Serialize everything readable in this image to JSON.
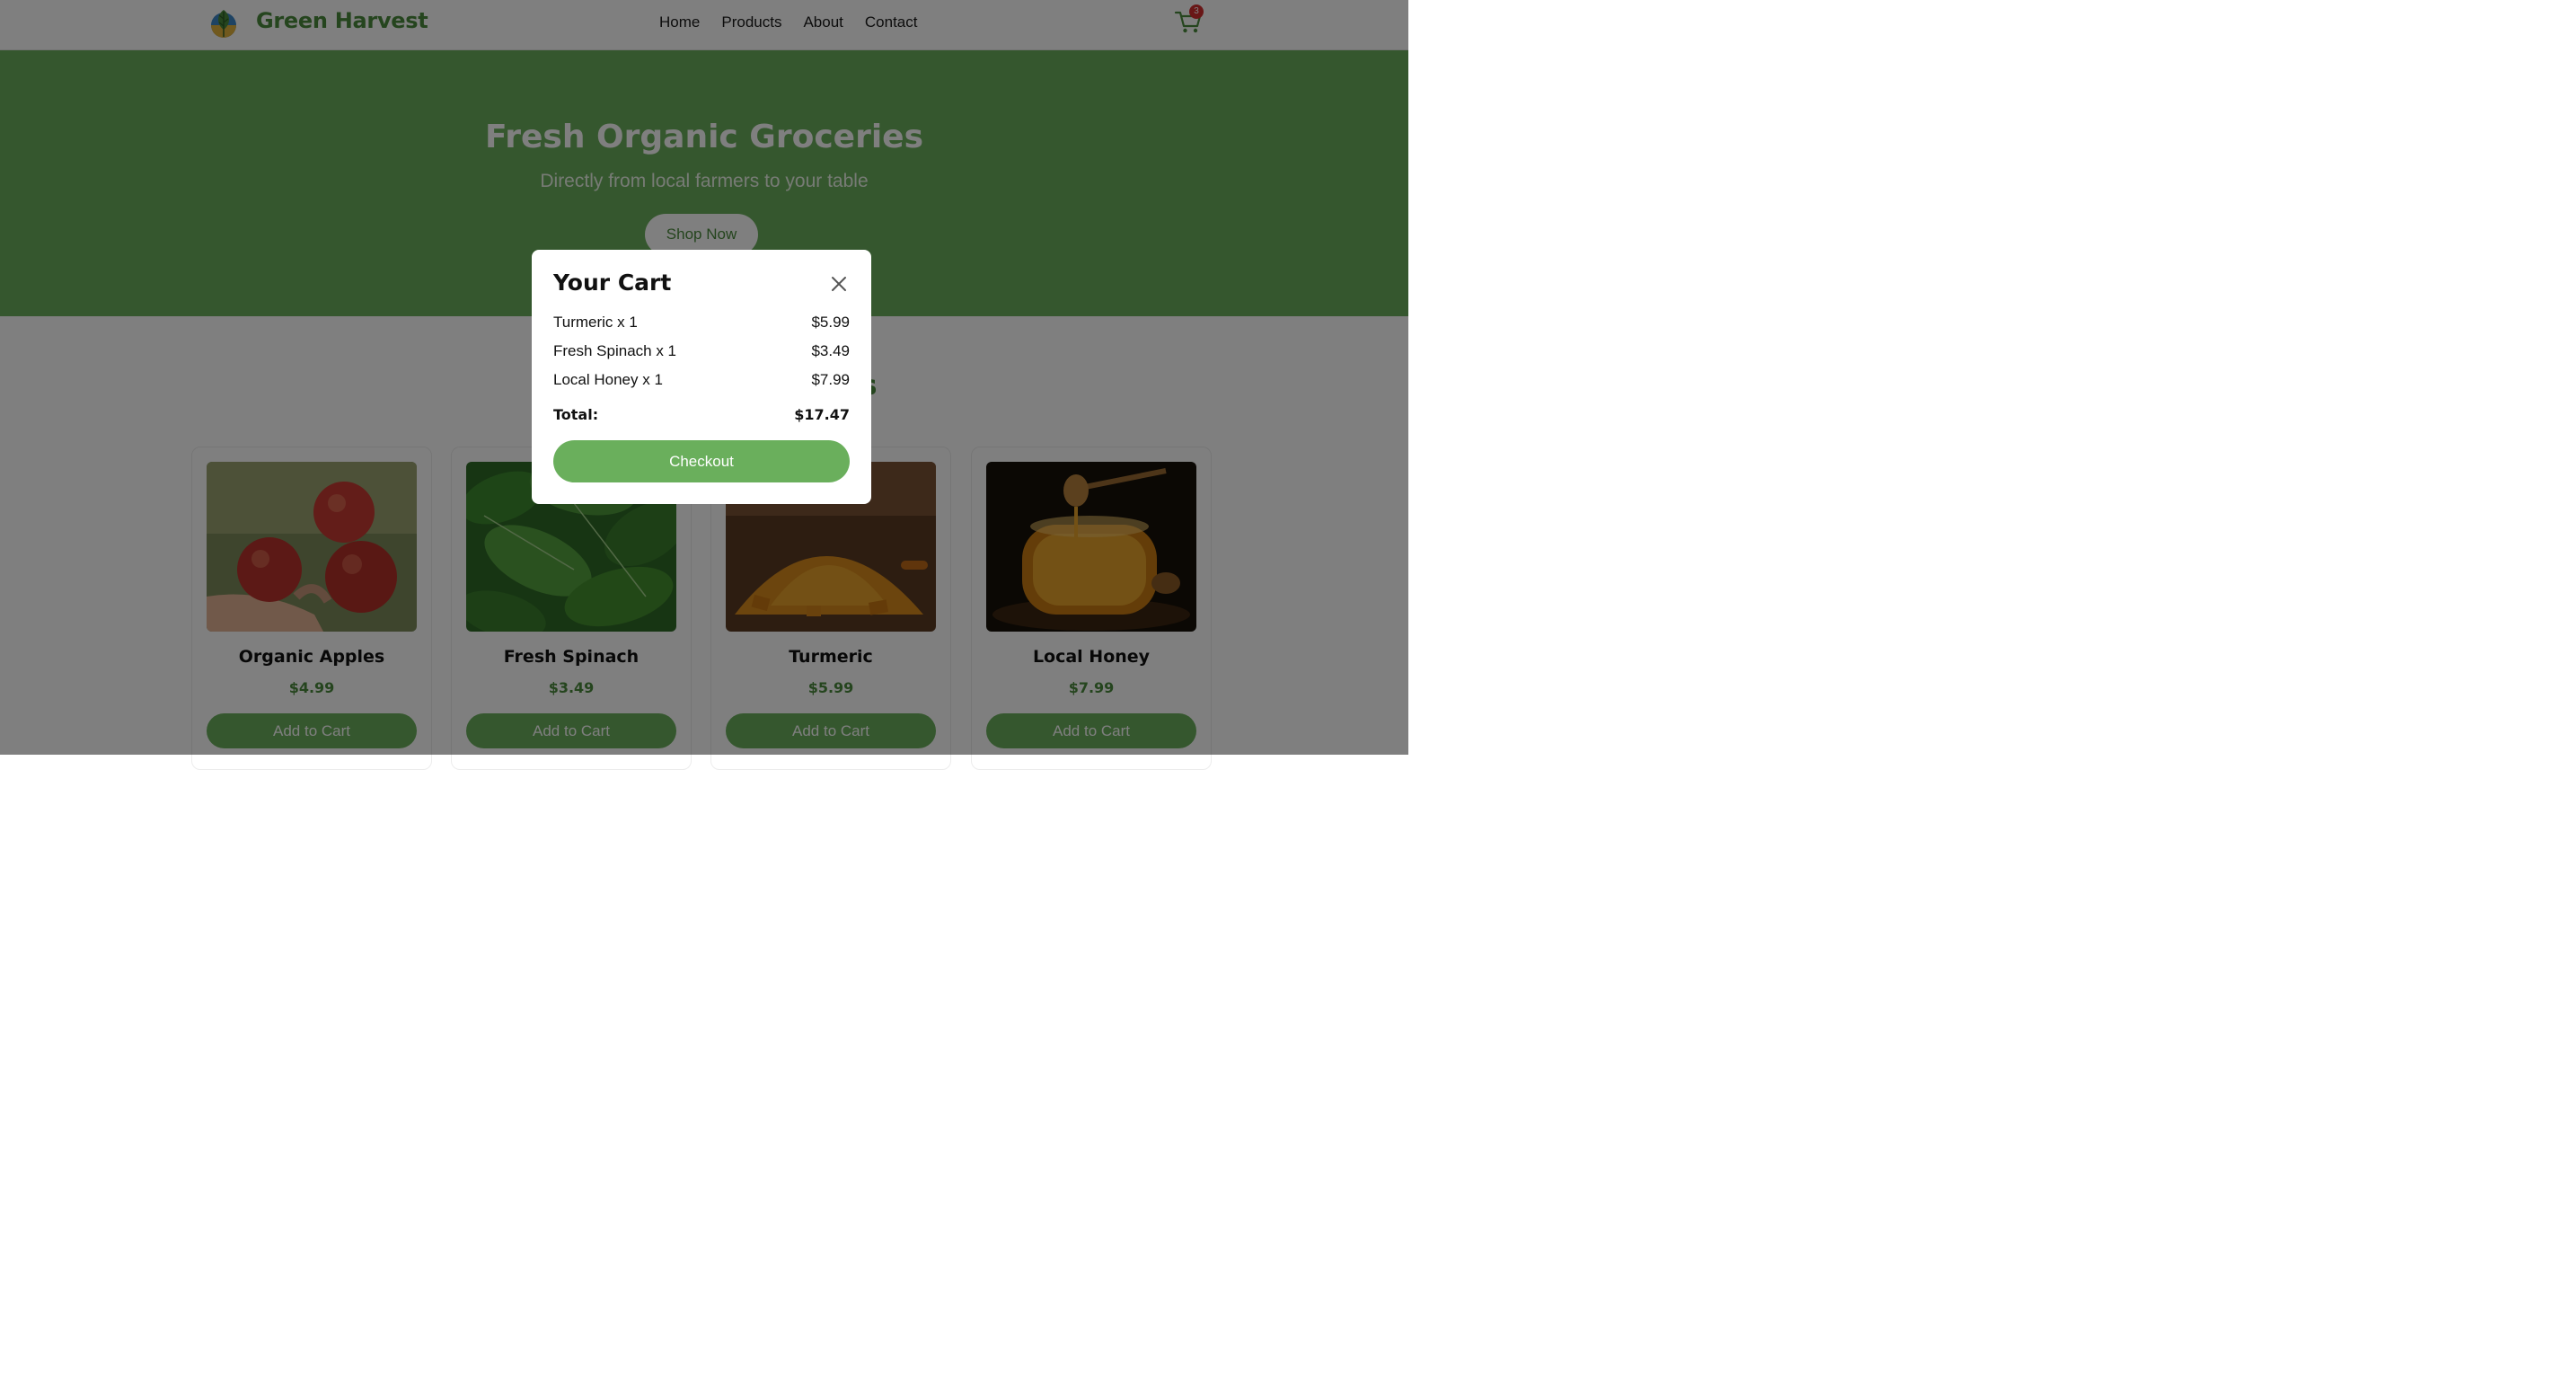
{
  "header": {
    "brand": "Green Harvest",
    "nav": [
      "Home",
      "Products",
      "About",
      "Contact"
    ],
    "cart_count": "3"
  },
  "hero": {
    "title": "Fresh Organic Groceries",
    "subtitle": "Directly from local farmers to your table",
    "cta": "Shop Now"
  },
  "section": {
    "title": "Our Featured Products"
  },
  "products": [
    {
      "name": "Organic Apples",
      "price": "$4.99",
      "button": "Add to Cart"
    },
    {
      "name": "Fresh Spinach",
      "price": "$3.49",
      "button": "Add to Cart"
    },
    {
      "name": "Turmeric",
      "price": "$5.99",
      "button": "Add to Cart"
    },
    {
      "name": "Local Honey",
      "price": "$7.99",
      "button": "Add to Cart"
    }
  ],
  "cart_modal": {
    "title": "Your Cart",
    "items": [
      {
        "name": "Turmeric x 1",
        "price": "$5.99"
      },
      {
        "name": "Fresh Spinach x 1",
        "price": "$3.49"
      },
      {
        "name": "Local Honey x 1",
        "price": "$7.99"
      }
    ],
    "total_label": "Total:",
    "total_value": "$17.47",
    "checkout_label": "Checkout"
  },
  "colors": {
    "brand_green": "#4a8a3c",
    "hero_green": "#6aaf5c",
    "badge_red": "#d32f2f"
  }
}
